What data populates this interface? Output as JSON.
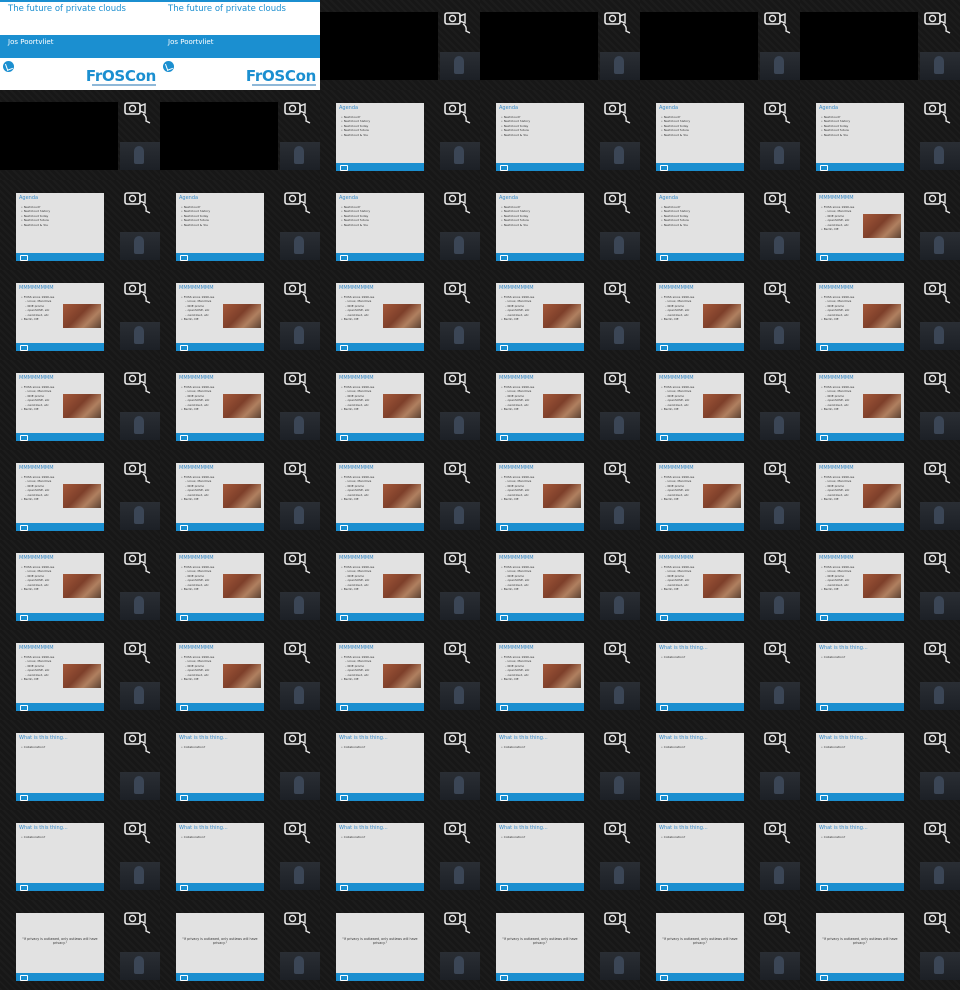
{
  "title_slide": {
    "title": "The future of private clouds",
    "author": "Jos Poortvliet",
    "brand": "FrOSCon"
  },
  "slides": {
    "agenda": {
      "title": "Agenda",
      "bullets": [
        "Nextcloud?",
        "Nextcloud history",
        "Nextcloud today",
        "Nextcloud future",
        "Nextcloud & You"
      ]
    },
    "history": {
      "title": "MMMMMMMM",
      "bullets": [
        "FOSS since 1990-ies",
        "Linux, Mandriva",
        "KDE promo",
        "openSUSE, etc",
        "ownCloud, etc",
        "Berlin, DE"
      ]
    },
    "what": {
      "title": "What is this thing...",
      "bullets": [
        "Collaboration?"
      ]
    },
    "privacy": {
      "quote": "\"If privacy is outlawed, only outlaws will have privacy.\""
    }
  },
  "sequence": [
    "title",
    "title",
    "black",
    "black",
    "black",
    "black",
    "black",
    "black",
    "agenda",
    "agenda",
    "agenda",
    "agenda",
    "agenda",
    "agenda",
    "agenda",
    "agenda",
    "agenda",
    "history",
    "history",
    "history",
    "history",
    "history",
    "history",
    "history",
    "history",
    "history",
    "history",
    "history",
    "history",
    "history",
    "history",
    "history",
    "history",
    "history",
    "history",
    "history",
    "history",
    "history",
    "history",
    "history",
    "history",
    "history",
    "history",
    "history",
    "history",
    "history",
    "what",
    "what",
    "what",
    "what",
    "what",
    "what",
    "what",
    "what",
    "what",
    "what",
    "what",
    "what",
    "what",
    "what",
    "privacy",
    "privacy",
    "privacy",
    "privacy",
    "privacy",
    "privacy"
  ]
}
